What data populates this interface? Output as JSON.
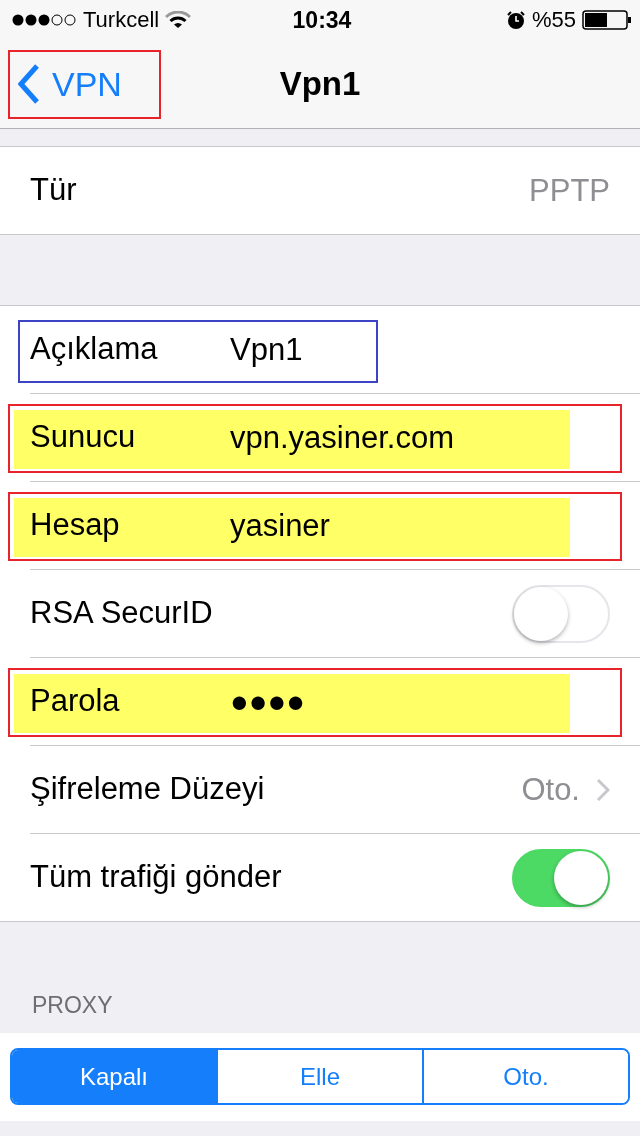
{
  "status_bar": {
    "carrier": "Turkcell",
    "time": "10:34",
    "battery_text": "%55"
  },
  "nav_bar": {
    "back": {
      "label": "VPN",
      "color": "#e8232a"
    },
    "title": "Vpn1"
  },
  "groups": [
    {
      "rows": [
        {
          "kind": "detail",
          "label": "Tür",
          "value": "PPTP"
        }
      ]
    },
    {
      "rows": [
        {
          "kind": "field",
          "label": "Açıklama",
          "value": "Vpn1",
          "color": "#3d43c5",
          "highlighted": false
        },
        {
          "kind": "field",
          "label": "Sunucu",
          "value": "vpn.yasiner.com",
          "color": "#e8232a",
          "highlighted": true
        },
        {
          "kind": "field",
          "label": "Hesap",
          "value": "yasiner",
          "color": "#e8232a",
          "highlighted": true
        },
        {
          "kind": "toggle",
          "label": "RSA SecurID",
          "on": false
        },
        {
          "kind": "field",
          "label": "Parola",
          "value": "●●●●",
          "color": "#e8232a",
          "highlighted": true
        },
        {
          "kind": "disclosure",
          "label": "Şifreleme Düzeyi",
          "value": "Oto."
        },
        {
          "kind": "toggle",
          "label": "Tüm trafiği gönder",
          "on": true
        }
      ]
    }
  ],
  "proxy": {
    "header": "PROXY",
    "segments": [
      {
        "label": "Kapalı",
        "selected": true
      },
      {
        "label": "Elle",
        "selected": false
      },
      {
        "label": "Oto.",
        "selected": false
      }
    ]
  }
}
